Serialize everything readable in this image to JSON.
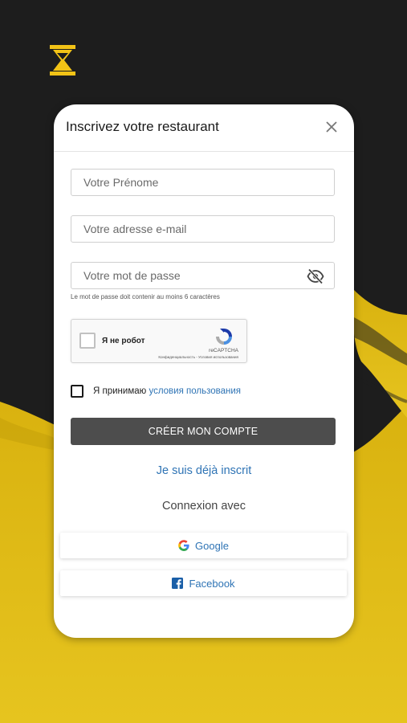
{
  "form": {
    "title": "Inscrivez votre restaurant",
    "first_name_placeholder": "Votre Prénome",
    "email_placeholder": "Votre adresse e-mail",
    "password_placeholder": "Votre mot de passe",
    "password_hint": "Le mot de passe doit contenir au moins 6 caractères"
  },
  "captcha": {
    "label": "Я не робот",
    "brand": "reCAPTCHA",
    "links": "Конфиденциальность - Условия использования"
  },
  "terms": {
    "text": "Я принимаю",
    "link": "условия пользования"
  },
  "actions": {
    "create_account": "CRÉER MON COMPTE",
    "already_registered": "Je suis déjà inscrit",
    "connect_with": "Connexion avec"
  },
  "social": {
    "google": "Google",
    "facebook": "Facebook"
  },
  "colors": {
    "accent_link": "#2f74b5",
    "button_bg": "#4d4d4d",
    "brand_yellow": "#e8c21a"
  },
  "icons": {
    "logo": "hourglass-icon",
    "close": "close-icon",
    "password_toggle": "eye-slash-icon",
    "captcha": "recaptcha-icon",
    "google": "google-icon",
    "facebook": "facebook-icon"
  }
}
